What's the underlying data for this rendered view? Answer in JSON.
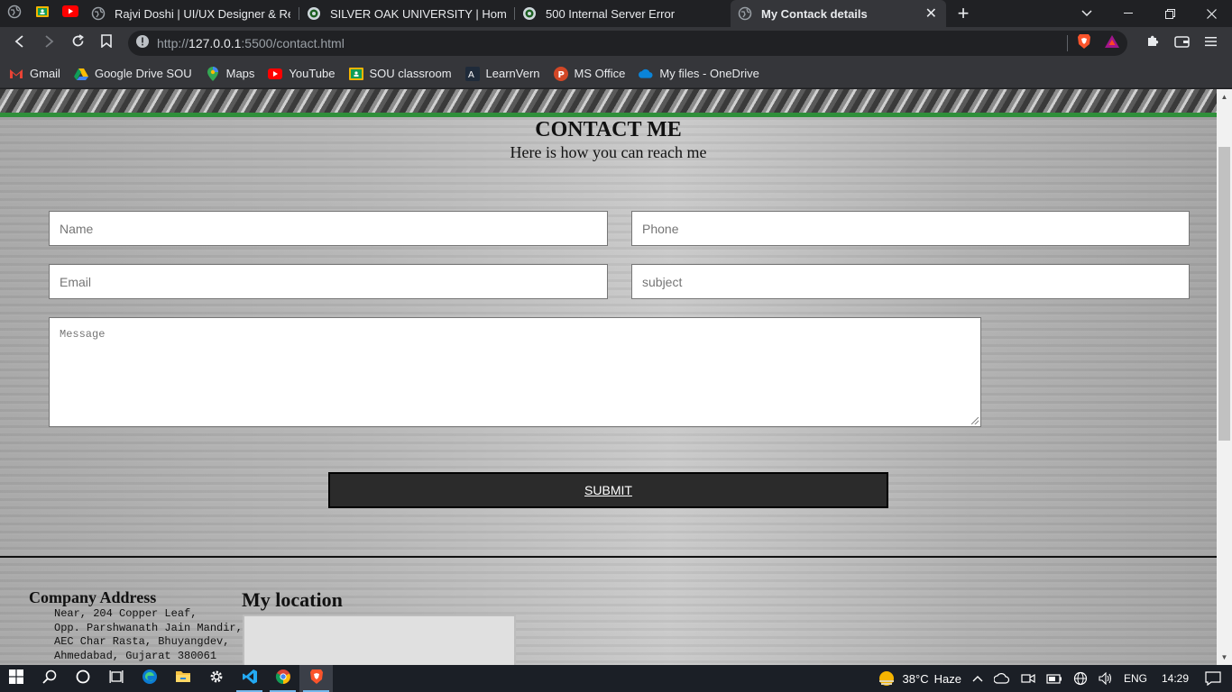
{
  "browser": {
    "tabs": [
      {
        "title": "Rajvi Doshi | UI/UX Designer & React D",
        "active": false
      },
      {
        "title": "SILVER OAK UNIVERSITY | Home",
        "active": false
      },
      {
        "title": "500 Internal Server Error",
        "active": false
      },
      {
        "title": "My Contack details",
        "active": true
      }
    ],
    "new_tab_label": "+",
    "url_host": "127.0.0.1",
    "url_prefix": "http://",
    "url_suffix": ":5500/contact.html",
    "bookmarks": [
      {
        "label": "Gmail",
        "icon": "gmail-icon"
      },
      {
        "label": "Google Drive SOU",
        "icon": "drive-icon"
      },
      {
        "label": "Maps",
        "icon": "maps-icon"
      },
      {
        "label": "YouTube",
        "icon": "youtube-icon"
      },
      {
        "label": "SOU classroom",
        "icon": "classroom-icon"
      },
      {
        "label": "LearnVern",
        "icon": "learnvern-icon"
      },
      {
        "label": "MS Office",
        "icon": "office-icon"
      },
      {
        "label": "My files - OneDrive",
        "icon": "onedrive-icon"
      }
    ]
  },
  "page": {
    "heading": "CONTACT ME",
    "subheading": "Here is how you can reach me",
    "form": {
      "name_placeholder": "Name",
      "phone_placeholder": "Phone",
      "email_placeholder": "Email",
      "subject_placeholder": "subject",
      "message_placeholder": "Message",
      "submit_label": "SUBMIT"
    },
    "address": {
      "title": "Company Address",
      "lines": [
        "Near, 204 Copper Leaf,",
        "Opp. Parshwanath Jain Mandir,",
        "AEC Char Rasta, Bhuyangdev,",
        "Ahmedabad, Gujarat 380061"
      ]
    },
    "location_title": "My location"
  },
  "taskbar": {
    "weather_temp": "38°C",
    "weather_text": "Haze",
    "language": "ENG",
    "time": "14:29"
  },
  "colors": {
    "accent_green": "#2f8f3a",
    "submit_bg": "#2b2b2b"
  }
}
